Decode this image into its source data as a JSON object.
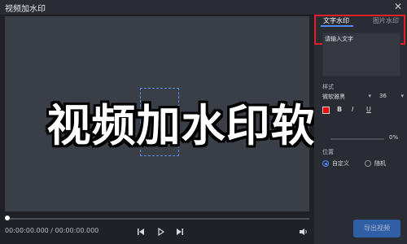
{
  "window": {
    "title": "视频加水印",
    "close_icon": "close-icon"
  },
  "overlay": {
    "title": "视频加水印软件"
  },
  "player": {
    "time": "00:00:00.000 / 00:00:00.000",
    "icons": {
      "prev": "prev-icon",
      "play": "play-icon",
      "next": "next-icon",
      "volume": "volume-icon"
    }
  },
  "panel": {
    "tabs": [
      {
        "label": "文字水印",
        "active": true
      },
      {
        "label": "图片水印",
        "active": false
      }
    ],
    "text_input": {
      "placeholder": "请输入文字",
      "value": ""
    },
    "style_label": "样式",
    "font_family": "微软雅黑",
    "font_size": "36",
    "format": {
      "bold": "B",
      "italic": "I",
      "underline": "U"
    },
    "opacity": {
      "value": "0%"
    },
    "position": {
      "label": "位置",
      "options": [
        {
          "label": "自定义",
          "selected": true
        },
        {
          "label": "随机",
          "selected": false
        }
      ]
    },
    "export_button": "导出视频",
    "colors": {
      "accent": "#4f8cff",
      "highlight_outline": "#e11f2a",
      "swatch": "#ff0000"
    }
  }
}
